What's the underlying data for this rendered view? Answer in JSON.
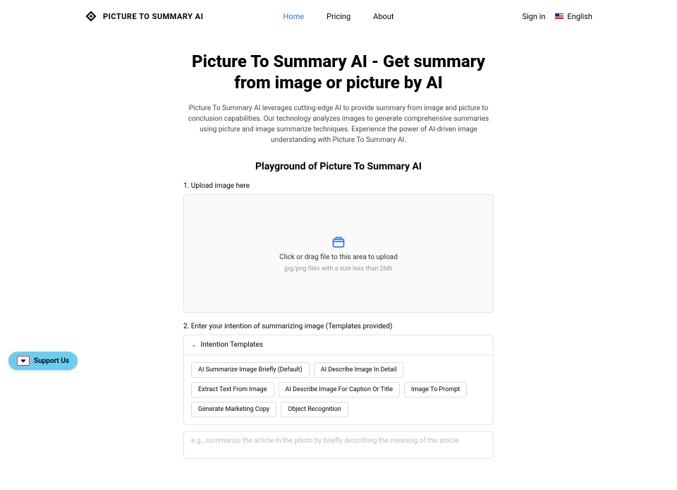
{
  "header": {
    "logo_text": "PICTURE TO SUMMARY AI",
    "nav": {
      "home": "Home",
      "pricing": "Pricing",
      "about": "About"
    },
    "sign_in": "Sign in",
    "language": "English"
  },
  "hero": {
    "title": "Picture To Summary AI - Get summary from image or picture by AI",
    "desc": "Picture To Summary AI leverages cutting-edge AI to provide summary from image and picture to conclusion capabilities. Our technology analyzes images to generate comprehensive summaries using picture and image summarize techniques. Experience the power of AI-driven image understanding with Picture To Summary AI."
  },
  "playground": {
    "title": "Playground of Picture To Summary AI",
    "step1_label": "1. Upload image here",
    "upload_text": "Click or drag file to this area to upload",
    "upload_hint": "jpg/png files with a size less than 2Mb",
    "step2_label": "2. Enter your intention of summarizing image (Templates provided)",
    "templates_title": "Intention Templates",
    "templates": [
      "AI Summarize Image Briefly (Default)",
      "AI Describe Image In Detail",
      "Extract Text From Image",
      "AI Describe Image For Caption Or Title",
      "Image To Prompt",
      "Generate Marketing Copy",
      "Object Recognition"
    ],
    "intention_placeholder": "e.g., summarize the article in the photo by briefly describing the meaning of the article"
  },
  "support": {
    "label": "Support Us"
  }
}
